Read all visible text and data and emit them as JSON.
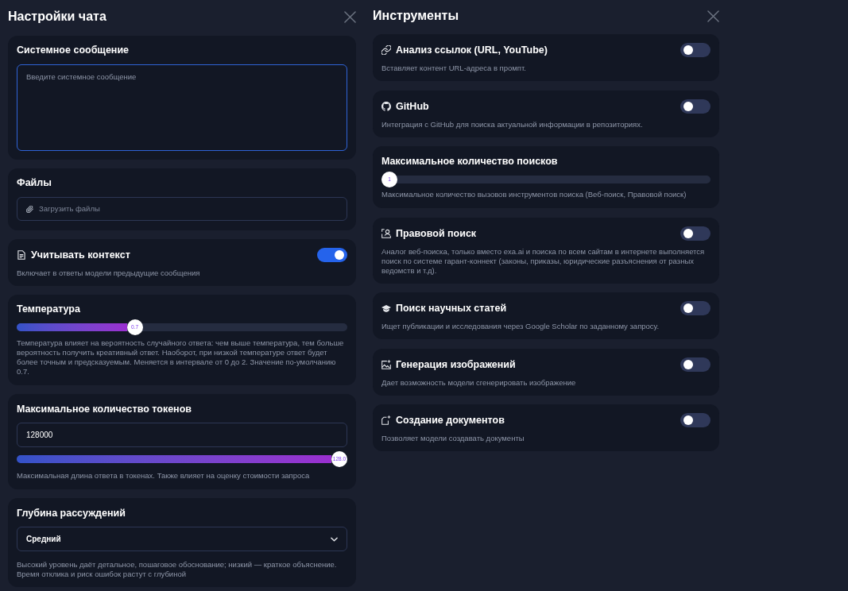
{
  "settings": {
    "title": "Настройки чата",
    "sections": [
      {
        "kind": "textarea",
        "title": "Системное сообщение",
        "placeholder": "Введите системное сообщение"
      },
      {
        "kind": "file",
        "title": "Файлы",
        "label": "Загрузить файлы"
      },
      {
        "kind": "toggle",
        "title": "Учитывать контекст",
        "on": true,
        "description": "Включает в ответы модели предыдущие сообщения"
      },
      {
        "kind": "slider",
        "title": "Температура",
        "level": 0.35,
        "thumb_label": "0.7",
        "description": "Температура влияет на вероятность случайного ответа: чем выше температура, тем больше вероятность получить креативный ответ. Наоборот, при низкой температуре ответ будет более точным и предсказуемым. Меняется в интервале от 0 до 2. Значение по-умолчанию 0.7."
      },
      {
        "kind": "number_slider",
        "title": "Максимальное количество токенов",
        "value": "128000",
        "level": 1,
        "thumb_label": "128.0",
        "description": "Максимальная длина ответа в токенах. Также влияет на оценку стоимости запроса"
      },
      {
        "kind": "select",
        "title": "Глубина рассуждений",
        "value": "Средний",
        "description": "Высокий уровень даёт детальное, пошаговое обоснование; низкий — краткое объяснение. Время отклика и риск ошибок растут с глубиной"
      }
    ]
  },
  "tools": {
    "title": "Инструменты",
    "items": [
      {
        "kind": "toggle",
        "title": "Анализ ссылок (URL, YouTube)",
        "on": false,
        "description": "Вставляет контент URL-адреса в промпт."
      },
      {
        "kind": "toggle",
        "title": "GitHub",
        "on": false,
        "description": "Интеграция с GitHub для поиска актуальной информации в репозиториях."
      },
      {
        "kind": "slider",
        "title": "Максимальное количество поисков",
        "level": 0,
        "thumb_label": "1",
        "description": "Максимальное количество вызовов инструментов поиска (Веб-поиск, Правовой поиск)"
      },
      {
        "kind": "toggle",
        "title": "Правовой поиск",
        "on": false,
        "description": "Аналог веб-поиска, только вместо exa.ai и поиска по всем сайтам в интернете выполняется поиск по системе гарант-коннект (законы, приказы, юридические разъяснения от разных ведомств и т.д)."
      },
      {
        "kind": "toggle",
        "title": "Поиск научных статей",
        "on": false,
        "description": "Ищет публикации и исследования через Google Scholar по заданному запросу."
      },
      {
        "kind": "toggle",
        "title": "Генерация изображений",
        "on": false,
        "description": "Дает возможность модели сгенерировать изображение"
      },
      {
        "kind": "toggle",
        "title": "Создание документов",
        "on": false,
        "description": "Позволяет модели создавать документы"
      }
    ]
  }
}
